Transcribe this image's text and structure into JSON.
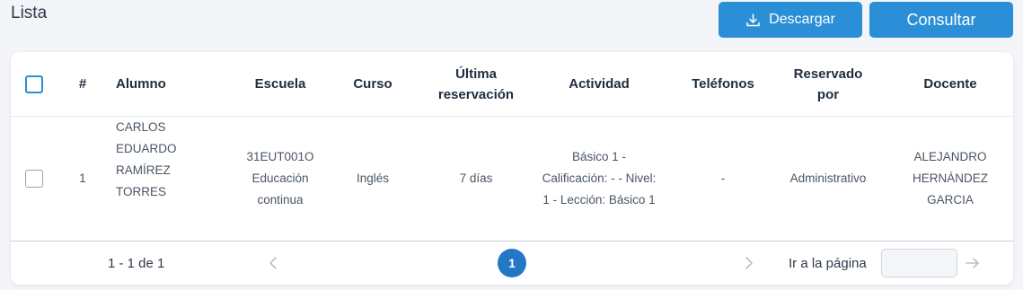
{
  "header": {
    "title": "Lista",
    "download_label": "Descargar",
    "query_label": "Consultar"
  },
  "table": {
    "columns": {
      "num": "#",
      "alumno": "Alumno",
      "escuela": "Escuela",
      "curso": "Curso",
      "ultima_l1": "Última",
      "ultima_l2": "reservación",
      "actividad": "Actividad",
      "telefonos": "Teléfonos",
      "reservado_l1": "Reservado",
      "reservado_l2": "por",
      "docente": "Docente"
    },
    "rows": [
      {
        "num": "1",
        "alumno": [
          "CARLOS",
          "EDUARDO",
          "RAMÍREZ",
          "TORRES"
        ],
        "escuela": [
          "31EUT001O",
          "Educación",
          "continua"
        ],
        "curso": "Inglés",
        "ultima": "7 días",
        "actividad": [
          "Básico 1 -",
          "Calificación: - - Nivel:",
          "1 - Lección: Básico 1"
        ],
        "telefonos": "-",
        "reservado": "Administrativo",
        "docente": [
          "ALEJANDRO",
          "HERNÁNDEZ",
          "GARCIA"
        ]
      }
    ]
  },
  "pagination": {
    "range": "1 - 1 de 1",
    "current_page": "1",
    "goto_label": "Ir a la página",
    "goto_value": ""
  },
  "colors": {
    "accent": "#2a8fd6",
    "page_active": "#2378c6"
  },
  "icons": {
    "download": "download-icon",
    "prev": "chevron-left-icon",
    "next": "chevron-right-icon",
    "go": "arrow-right-icon"
  }
}
